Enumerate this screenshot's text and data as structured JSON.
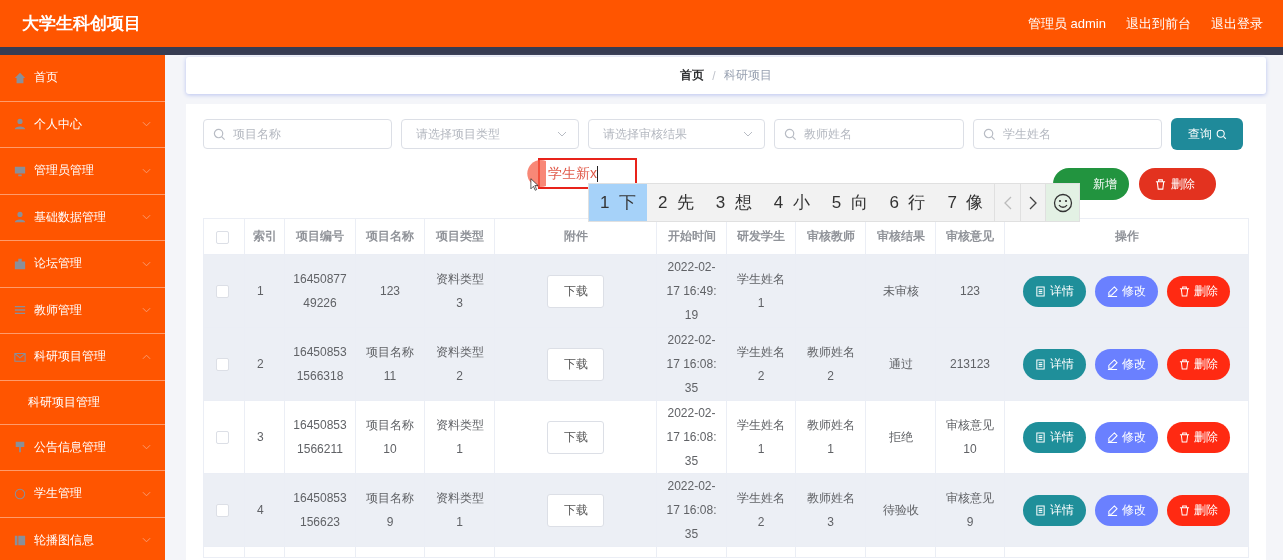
{
  "header": {
    "title": "大学生科创项目",
    "links": [
      "管理员 admin",
      "退出到前台",
      "退出登录"
    ]
  },
  "sidebar": {
    "items": [
      {
        "label": "首页",
        "kind": "link"
      },
      {
        "label": "个人中心",
        "kind": "group",
        "expanded": false
      },
      {
        "label": "管理员管理",
        "kind": "group",
        "expanded": false
      },
      {
        "label": "基础数据管理",
        "kind": "group",
        "expanded": false
      },
      {
        "label": "论坛管理",
        "kind": "group",
        "expanded": false
      },
      {
        "label": "教师管理",
        "kind": "group",
        "expanded": false
      },
      {
        "label": "科研项目管理",
        "kind": "group",
        "expanded": true,
        "children": [
          {
            "label": "科研项目管理"
          }
        ]
      },
      {
        "label": "公告信息管理",
        "kind": "group",
        "expanded": false
      },
      {
        "label": "学生管理",
        "kind": "group",
        "expanded": false
      },
      {
        "label": "轮播图信息",
        "kind": "group",
        "expanded": false
      }
    ]
  },
  "breadcrumb": {
    "items": [
      "首页",
      "科研项目"
    ],
    "separator": "/"
  },
  "search": {
    "fields": [
      {
        "kind": "text",
        "placeholder": "项目名称"
      },
      {
        "kind": "select",
        "placeholder": "请选择项目类型"
      },
      {
        "kind": "select",
        "placeholder": "请选择审核结果"
      },
      {
        "kind": "text",
        "placeholder": "教师姓名"
      },
      {
        "kind": "text",
        "placeholder": "学生姓名"
      }
    ],
    "button": "查询"
  },
  "actions": [
    {
      "kind": "add",
      "label": "新增"
    },
    {
      "kind": "delete",
      "label": "删除"
    }
  ],
  "table": {
    "header_checked": false,
    "columns": [
      "索引",
      "项目编号",
      "项目名称",
      "项目类型",
      "附件",
      "开始时间",
      "研发学生",
      "审核教师",
      "审核结果",
      "审核意见",
      "操作"
    ],
    "rows": [
      {
        "shaded": true,
        "checked": false,
        "cells": [
          "1",
          "1645087749226",
          "123",
          "资料类型3",
          "下载",
          "2022-02-17 16:49:19",
          "学生姓名1",
          "",
          "未审核",
          "123"
        ],
        "buttons": [
          {
            "kind": "detail",
            "label": "详情"
          },
          {
            "kind": "edit",
            "label": "修改"
          },
          {
            "kind": "delete",
            "label": "删除"
          }
        ]
      },
      {
        "shaded": true,
        "checked": false,
        "cells": [
          "2",
          "164508531566318",
          "项目名称11",
          "资料类型2",
          "下载",
          "2022-02-17 16:08:35",
          "学生姓名2",
          "教师姓名2",
          "通过",
          "213123"
        ],
        "buttons": [
          {
            "kind": "detail",
            "label": "详情"
          },
          {
            "kind": "edit",
            "label": "修改"
          },
          {
            "kind": "delete",
            "label": "删除"
          }
        ]
      },
      {
        "shaded": false,
        "checked": false,
        "cells": [
          "3",
          "164508531566211",
          "项目名称10",
          "资料类型1",
          "下载",
          "2022-02-17 16:08:35",
          "学生姓名1",
          "教师姓名1",
          "拒绝",
          "审核意见10"
        ],
        "buttons": [
          {
            "kind": "detail",
            "label": "详情"
          },
          {
            "kind": "edit",
            "label": "修改"
          },
          {
            "kind": "delete",
            "label": "删除"
          }
        ]
      },
      {
        "shaded": true,
        "checked": false,
        "cells": [
          "4",
          "16450853156623",
          "项目名称9",
          "资料类型1",
          "下载",
          "2022-02-17 16:08:35",
          "学生姓名2",
          "教师姓名3",
          "待验收",
          "审核意见9"
        ],
        "buttons": [
          {
            "kind": "detail",
            "label": "详情"
          },
          {
            "kind": "edit",
            "label": "修改"
          },
          {
            "kind": "delete",
            "label": "删除"
          }
        ]
      }
    ]
  },
  "ime": {
    "composition": "学生新x",
    "candidates": [
      {
        "number": "1",
        "char": "下",
        "selected": true
      },
      {
        "number": "2",
        "char": "先",
        "selected": false
      },
      {
        "number": "3",
        "char": "想",
        "selected": false
      },
      {
        "number": "4",
        "char": "小",
        "selected": false
      },
      {
        "number": "5",
        "char": "向",
        "selected": false
      },
      {
        "number": "6",
        "char": "行",
        "selected": false
      },
      {
        "number": "7",
        "char": "像",
        "selected": false
      }
    ]
  }
}
